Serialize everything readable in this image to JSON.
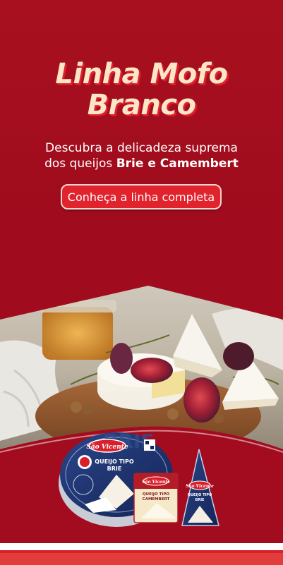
{
  "headline": {
    "line1": "Linha Mofo",
    "line2": "Branco"
  },
  "subtitle": {
    "line1": "Descubra a delicadeza suprema",
    "line2_prefix": "dos queijos ",
    "line2_bold": "Brie e Camembert"
  },
  "cta": {
    "label": "Conheça a linha completa"
  },
  "products": {
    "brand": "São Vicente",
    "round_pack": {
      "line1": "QUEIJO TIPO",
      "line2": "BRIE",
      "bg_text": "BRIE"
    },
    "square_pack": {
      "line1": "QUEIJO TIPO",
      "line2": "CAMEMBERT"
    },
    "wedge_pack": {
      "line1": "QUEIJO TIPO",
      "line2": "BRIE"
    }
  },
  "colors": {
    "background": "#a50d1f",
    "headline_text": "#fbe7c8",
    "headline_shadow": "#e0222f",
    "cta_background": "#e1232d",
    "cta_border": "#f7d6cf",
    "package_navy": "#1c2f6e"
  }
}
